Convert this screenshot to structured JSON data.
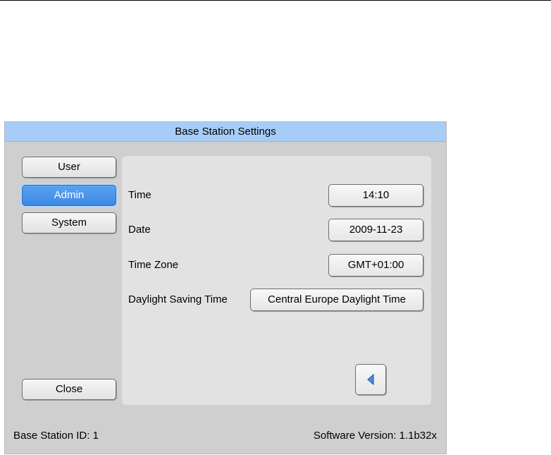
{
  "window": {
    "title": "Base Station Settings"
  },
  "nav": {
    "items": [
      {
        "label": "User",
        "active": false
      },
      {
        "label": "Admin",
        "active": true
      },
      {
        "label": "System",
        "active": false
      }
    ],
    "close_label": "Close"
  },
  "settings": {
    "time": {
      "label": "Time",
      "value": "14:10"
    },
    "date": {
      "label": "Date",
      "value": "2009-11-23"
    },
    "time_zone": {
      "label": "Time Zone",
      "value": "GMT+01:00"
    },
    "daylight_saving": {
      "label": "Daylight Saving Time",
      "value": "Central Europe Daylight Time"
    }
  },
  "footer": {
    "base_station_label": "Base Station ID:",
    "base_station_id": "1",
    "software_label": "Software Version:",
    "software_version": "1.1b32x"
  },
  "colors": {
    "titlebar": "#a7cdf6",
    "active_button": "#3d88e3",
    "window_bg": "#cfcfcf",
    "panel_bg": "#e2e2e2"
  },
  "icons": {
    "back": "triangle-left-icon"
  }
}
